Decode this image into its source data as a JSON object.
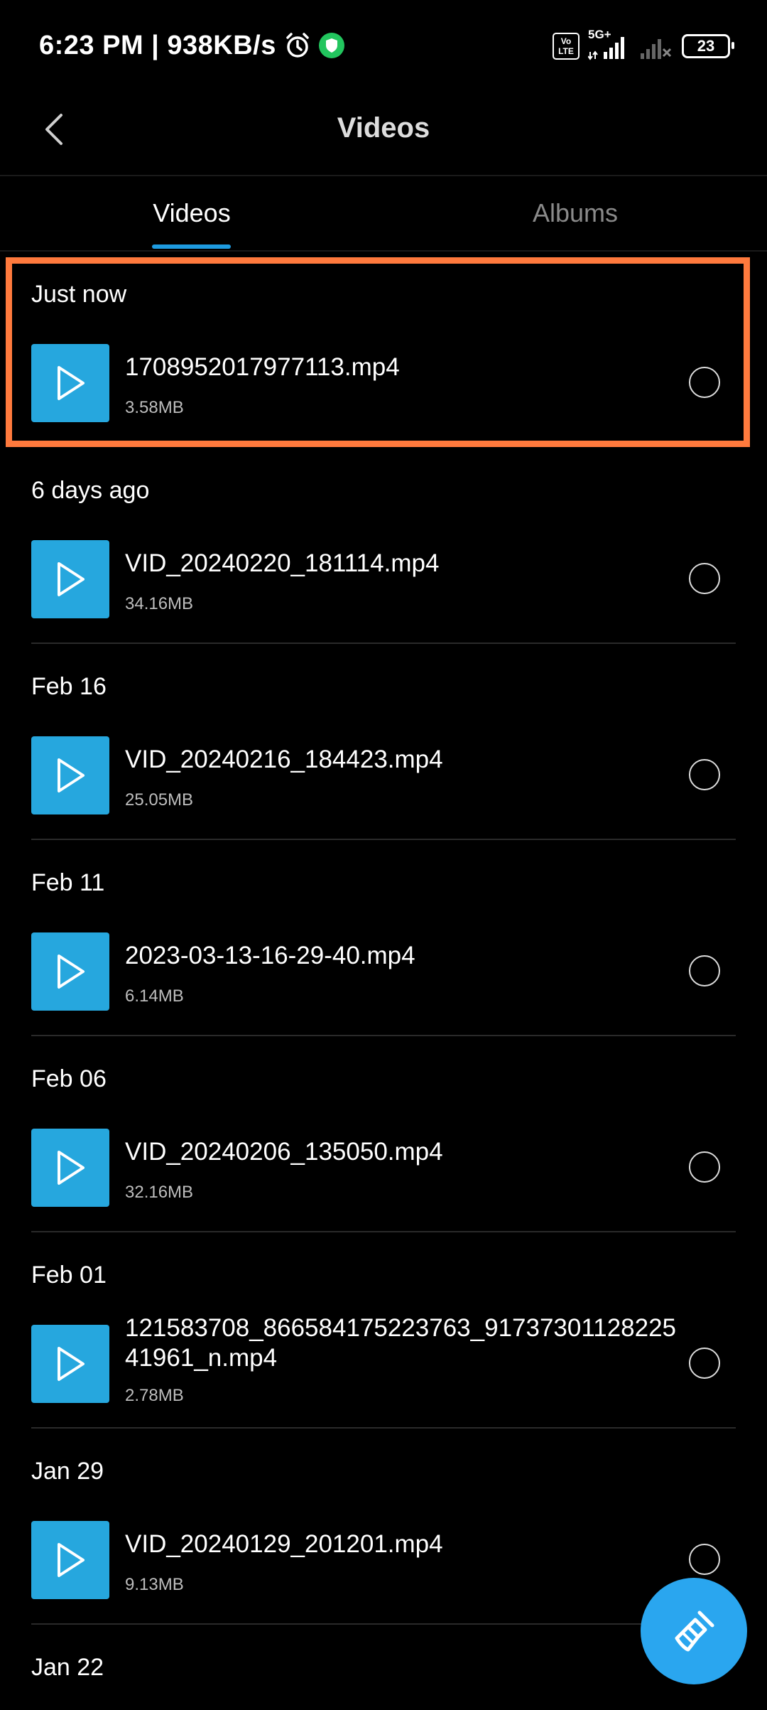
{
  "status_bar": {
    "time": "6:23 PM",
    "speed": "938KB/s",
    "network": "5G+",
    "volte": [
      "Vo",
      "LTE"
    ],
    "battery": "23"
  },
  "header": {
    "title": "Videos"
  },
  "tabs": [
    {
      "label": "Videos",
      "active": true
    },
    {
      "label": "Albums",
      "active": false
    }
  ],
  "groups": [
    {
      "date": "Just now",
      "items": [
        {
          "name": "1708952017977113.mp4",
          "size": "3.58MB"
        }
      ]
    },
    {
      "date": "6 days ago",
      "items": [
        {
          "name": "VID_20240220_181114.mp4",
          "size": "34.16MB"
        }
      ]
    },
    {
      "date": "Feb 16",
      "items": [
        {
          "name": "VID_20240216_184423.mp4",
          "size": "25.05MB"
        }
      ]
    },
    {
      "date": "Feb 11",
      "items": [
        {
          "name": "2023-03-13-16-29-40.mp4",
          "size": "6.14MB"
        }
      ]
    },
    {
      "date": "Feb 06",
      "items": [
        {
          "name": "VID_20240206_135050.mp4",
          "size": "32.16MB"
        }
      ]
    },
    {
      "date": "Feb 01",
      "items": [
        {
          "name": "121583708_866584175223763_9173730112822541961_n.mp4",
          "size": "2.78MB"
        }
      ]
    },
    {
      "date": "Jan 29",
      "items": [
        {
          "name": "VID_20240129_201201.mp4",
          "size": "9.13MB"
        }
      ]
    },
    {
      "date": "Jan 22",
      "items": []
    }
  ],
  "colors": {
    "accent": "#1e9be0",
    "thumb": "#26a7de",
    "highlight": "#ff7a3d",
    "fab": "#2aa6ef"
  }
}
